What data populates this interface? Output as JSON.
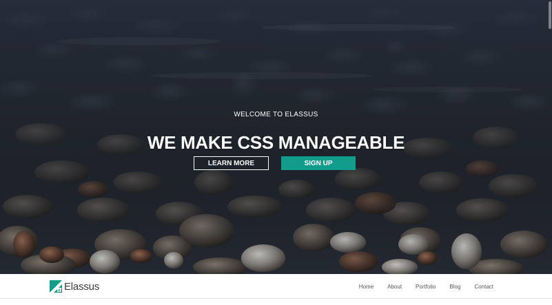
{
  "hero": {
    "subtitle": "WELCOME TO ELASSUS",
    "title": "WE MAKE CSS MANAGEABLE",
    "learn_more_label": "LEARN MORE",
    "signup_label": "SIGN UP",
    "signup_color": "#119c8c",
    "background": "rocks-under-water-photo"
  },
  "navbar": {
    "brand_name": "Elassus",
    "brand_logo_icon": "elassus-logo-icon",
    "links": [
      {
        "label": "Home"
      },
      {
        "label": "About"
      },
      {
        "label": "Portfolio"
      },
      {
        "label": "Blog"
      },
      {
        "label": "Contact"
      }
    ],
    "logo_colors": {
      "primary": "#119c8c",
      "dark": "#0b6f63"
    }
  }
}
